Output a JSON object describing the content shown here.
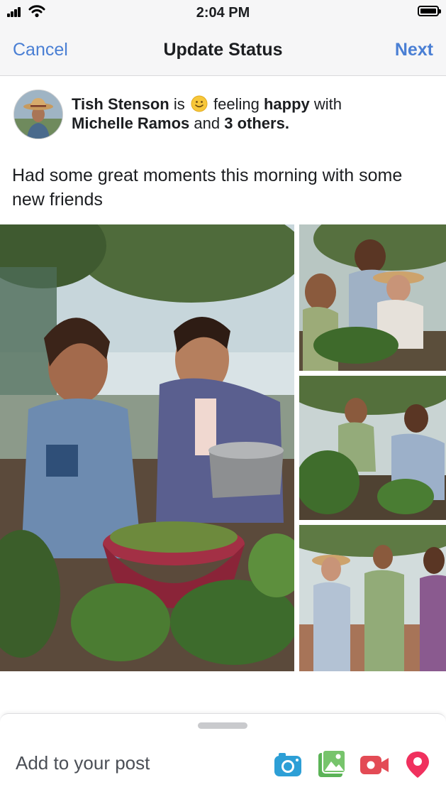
{
  "status_bar": {
    "time": "2:04 PM"
  },
  "nav": {
    "cancel_label": "Cancel",
    "title": "Update Status",
    "next_label": "Next"
  },
  "header": {
    "user_name": "Tish Stenson",
    "word_is": "is",
    "word_feeling": "feeling",
    "feeling": "happy",
    "word_with": "with",
    "tagged_name": "Michelle Ramos",
    "word_and": "and",
    "others": "3 others."
  },
  "post": {
    "text": "Had some great moments this morning with some new friends"
  },
  "sheet": {
    "add_label": "Add to your post",
    "tools": [
      "camera-icon",
      "photo-gallery-icon",
      "video-icon",
      "location-pin-icon"
    ]
  },
  "colors": {
    "link_blue": "#4a7fd4",
    "camera": "#2d9fd6",
    "gallery": "#5bb357",
    "video": "#e34b55",
    "location": "#f0315e"
  }
}
